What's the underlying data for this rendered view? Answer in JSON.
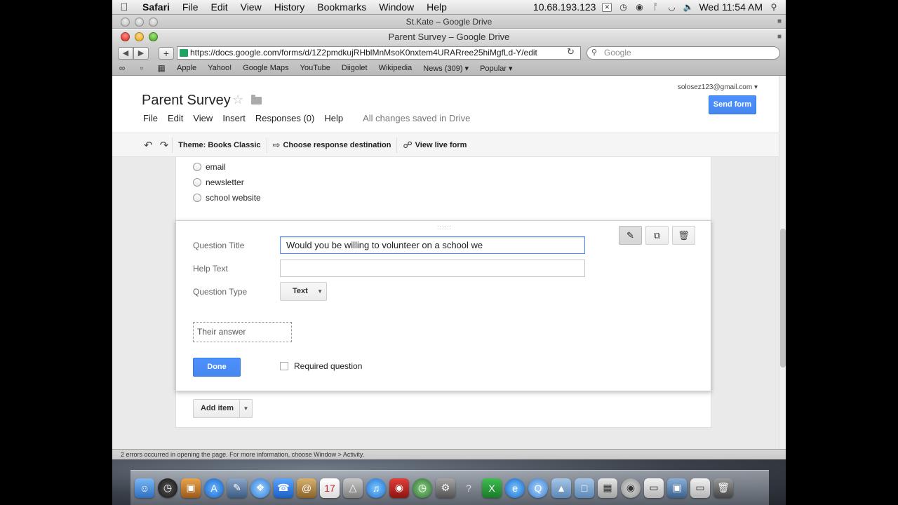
{
  "menubar": {
    "app": "Safari",
    "items": [
      "File",
      "Edit",
      "View",
      "History",
      "Bookmarks",
      "Window",
      "Help"
    ],
    "ip": "10.68.193.123",
    "clock": "Wed 11:54 AM"
  },
  "window": {
    "tab_title": "St.Kate – Google Drive",
    "title": "Parent Survey – Google Drive",
    "url": "https://docs.google.com/forms/d/1Z2pmdkujRHblMnMsoK0nxtem4URARree25hiMgfLd-Y/edit",
    "search_placeholder": "Google"
  },
  "bookmarks": [
    "Apple",
    "Yahoo!",
    "Google Maps",
    "YouTube",
    "Diigolet",
    "Wikipedia",
    "News (309) ▾",
    "Popular ▾"
  ],
  "form_header": {
    "title": "Parent Survey",
    "account": "solosez123@gmail.com ▾",
    "send_label": "Send form",
    "menu": [
      "File",
      "Edit",
      "View",
      "Insert",
      "Responses (0)",
      "Help"
    ],
    "saved_status": "All changes saved in Drive"
  },
  "form_toolbar": {
    "theme": "Theme: Books Classic",
    "destination": "Choose response destination",
    "live": "View live form"
  },
  "prev_question": {
    "options": [
      "email",
      "newsletter",
      "school website"
    ]
  },
  "editor": {
    "title_label": "Question Title",
    "title_value": "Would you be willing to volunteer on a school we",
    "help_label": "Help Text",
    "help_value": "",
    "type_label": "Question Type",
    "type_value": "Text",
    "answer_placeholder": "Their answer",
    "done_label": "Done",
    "required_label": "Required question"
  },
  "add_item_label": "Add item",
  "status_bar": "2 errors occurred in opening the page. For more information, choose Window > Activity.",
  "colors": {
    "blue_button": "#4d90fe",
    "sheets_green": "#1fa463"
  }
}
